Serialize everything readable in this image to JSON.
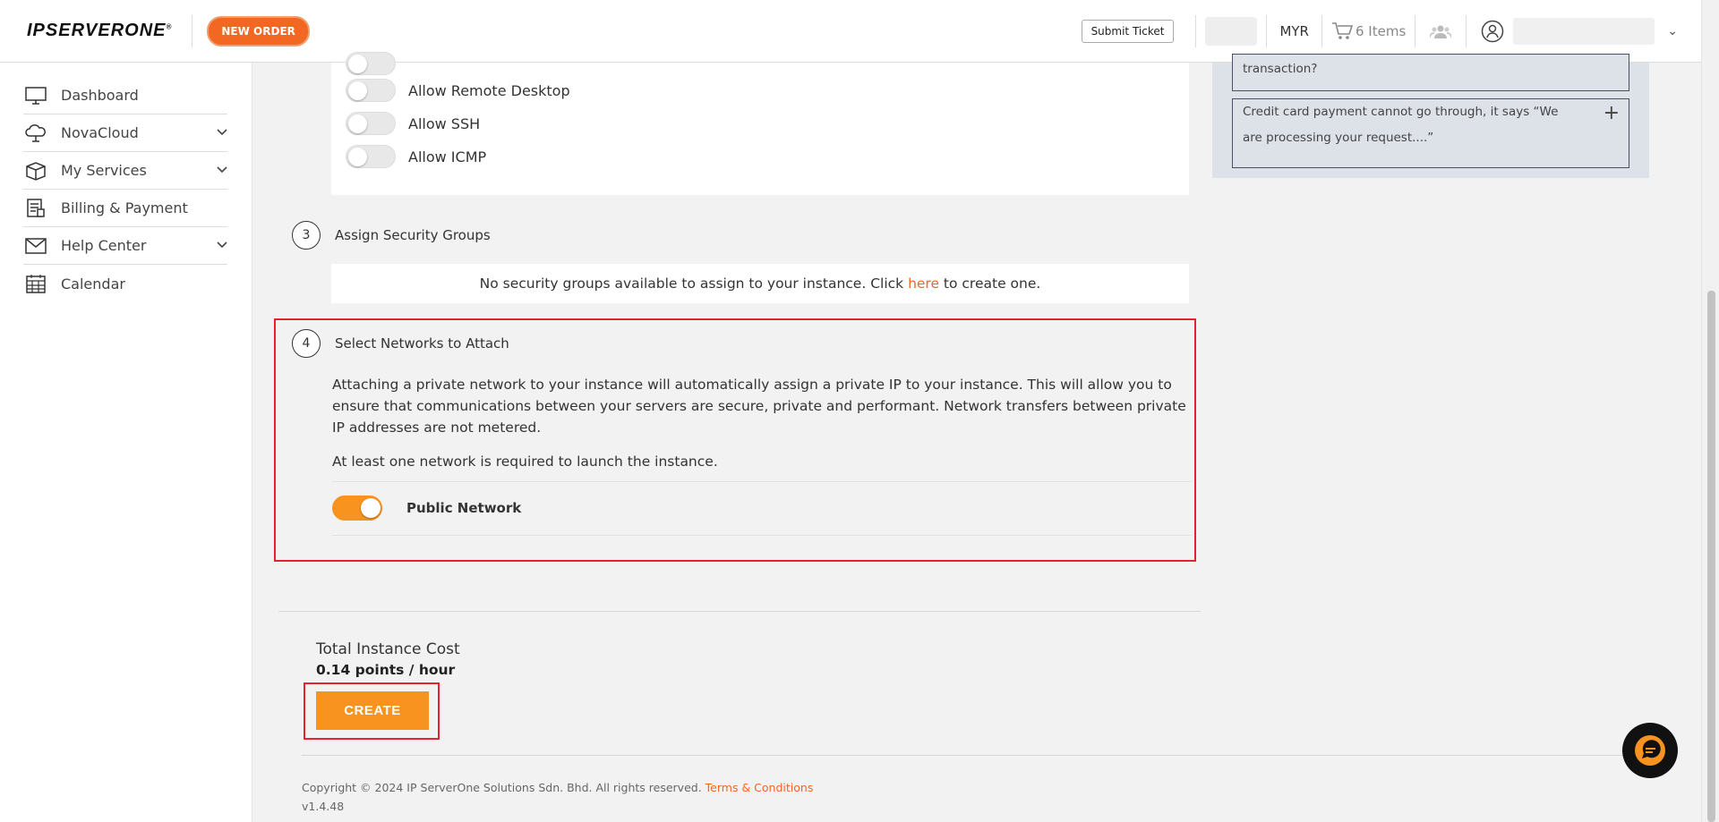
{
  "header": {
    "logo": "IPSERVERONE",
    "new_order": "NEW ORDER",
    "submit_ticket": "Submit Ticket",
    "currency": "MYR",
    "cart": "6 Items"
  },
  "sidebar": {
    "items": [
      {
        "label": "Dashboard"
      },
      {
        "label": "NovaCloud"
      },
      {
        "label": "My Services"
      },
      {
        "label": "Billing & Payment"
      },
      {
        "label": "Help Center"
      },
      {
        "label": "Calendar"
      }
    ]
  },
  "firewall": {
    "toggles": [
      {
        "label": "Allow Remote Desktop"
      },
      {
        "label": "Allow SSH"
      },
      {
        "label": "Allow ICMP"
      }
    ]
  },
  "step3": {
    "number": "3",
    "title": "Assign Security Groups",
    "notice_prefix": "No security groups available to assign to your instance. Click ",
    "notice_link": "here",
    "notice_suffix": " to create one."
  },
  "step4": {
    "number": "4",
    "title": "Select Networks to Attach",
    "description": "Attaching a private network to your instance will automatically assign a private IP to your instance. This will allow you to ensure that communications between your servers are secure, private and performant. Network transfers between private IP addresses are not metered.",
    "requirement": "At least one network is required to launch the instance.",
    "network_label": "Public Network"
  },
  "cost": {
    "title": "Total Instance Cost",
    "value": "0.14 points / hour",
    "create_button": "CREATE"
  },
  "footer": {
    "copyright": "Copyright © 2024 IP ServerOne Solutions Sdn. Bhd. All rights reserved.",
    "terms": "Terms & Conditions",
    "version": "v1.4.48"
  },
  "faq": {
    "partial": "transaction?",
    "question": "Credit card payment cannot go through, it says “We are processing your request....”",
    "plus": "+"
  },
  "colors": {
    "accent": "#f7931e",
    "brand_orange": "#f26722",
    "highlight_red": "#e3242b"
  }
}
